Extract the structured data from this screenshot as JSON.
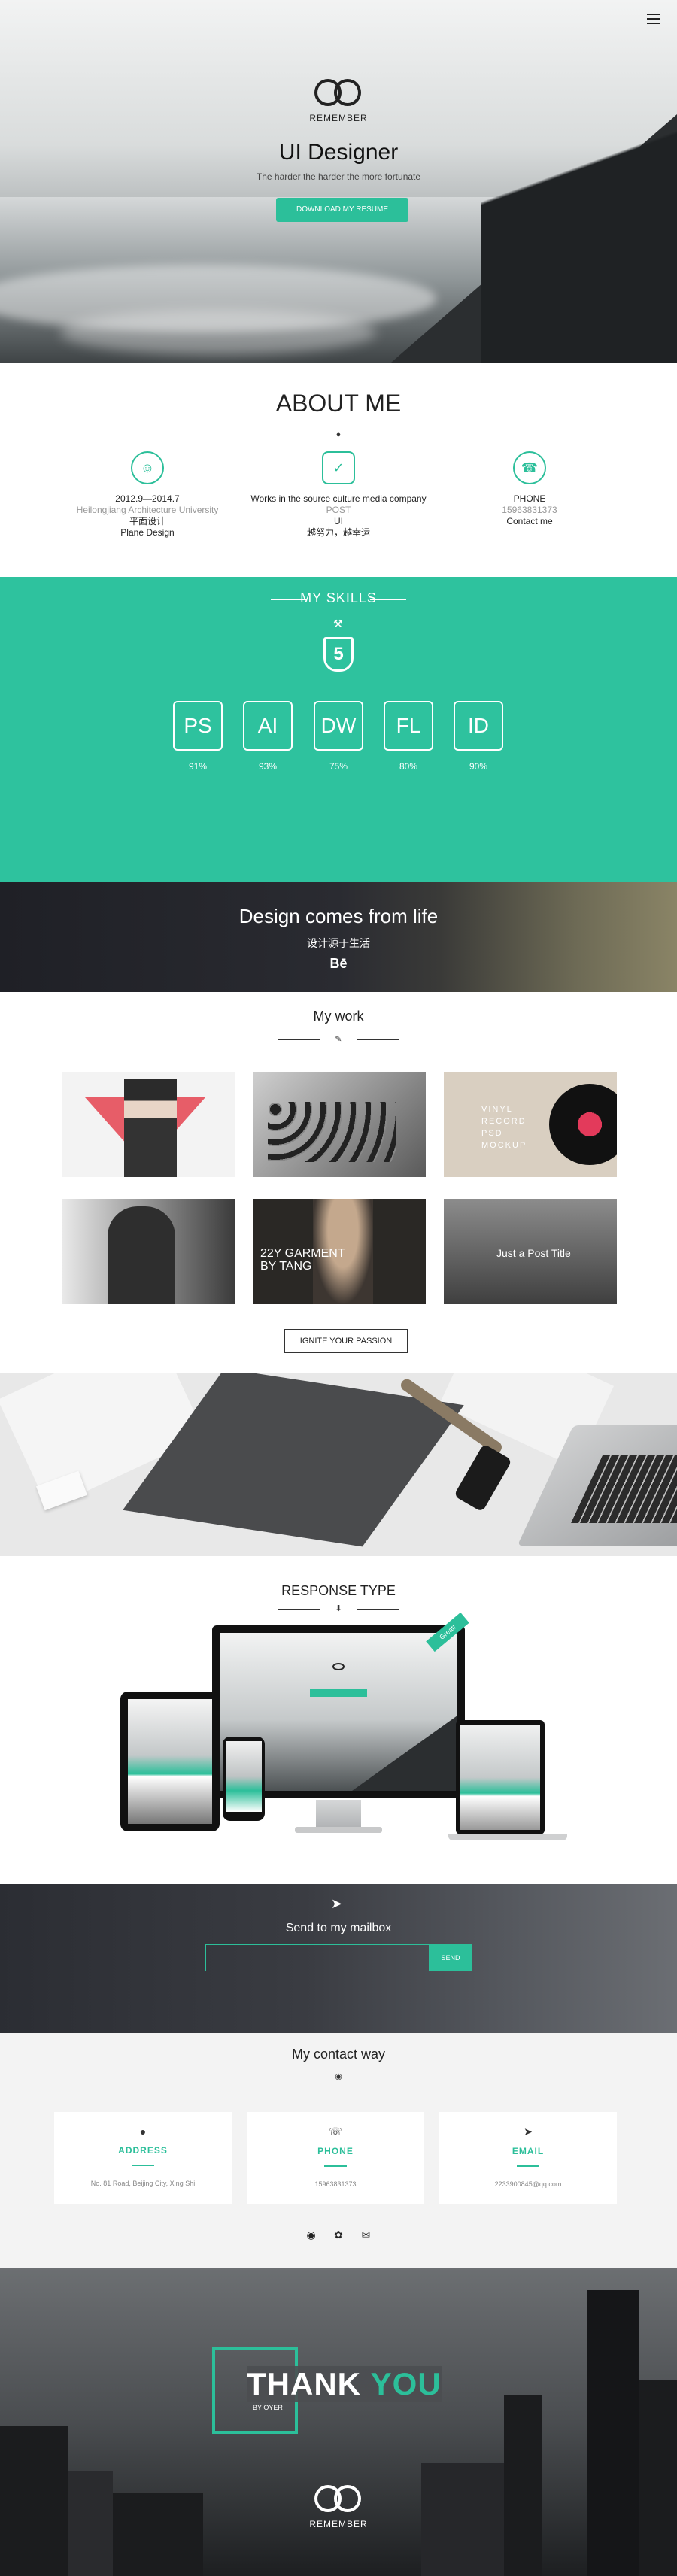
{
  "hero": {
    "logo_text": "REMEMBER",
    "title": "UI Designer",
    "tagline": "The harder the harder the more fortunate",
    "button": "DOWNLOAD MY RESUME"
  },
  "about": {
    "title": "ABOUT ME",
    "cols": [
      {
        "lines": [
          "2012.9—2014.7",
          "Heilongjiang Architecture University",
          "平面设计",
          "Plane Design"
        ]
      },
      {
        "lines": [
          "Works in the source culture media company",
          "POST",
          "UI",
          "越努力，越幸运"
        ]
      },
      {
        "lines": [
          "PHONE",
          "15963831373",
          "Contact me"
        ]
      }
    ]
  },
  "skills": {
    "title": "MY SKILLS",
    "badge": "5",
    "items": [
      {
        "label": "PS",
        "pct": "91%"
      },
      {
        "label": "AI",
        "pct": "93%"
      },
      {
        "label": "DW",
        "pct": "75%"
      },
      {
        "label": "FL",
        "pct": "80%"
      },
      {
        "label": "ID",
        "pct": "90%"
      }
    ]
  },
  "quote": {
    "line1": "Design comes from life",
    "line2": "设计源于生活",
    "line3": "Bē"
  },
  "work": {
    "title": "My work",
    "tiles": [
      {
        "caption": ""
      },
      {
        "caption": ""
      },
      {
        "caption": "VINYL RECORD PSD MOCKUP"
      },
      {
        "caption": ""
      },
      {
        "caption": "22Y GARMENT BY TANG"
      },
      {
        "caption": "Just a Post Title"
      }
    ],
    "button": "IGNITE YOUR PASSION"
  },
  "response": {
    "title": "RESPONSE TYPE",
    "ribbon": "Great!"
  },
  "mail": {
    "title": "Send to my mailbox",
    "placeholder": "",
    "button": "SEND"
  },
  "contact": {
    "title": "My contact way",
    "cards": [
      {
        "label": "ADDRESS",
        "value": "No. 81 Road, Beijing City, Xing Shi"
      },
      {
        "label": "PHONE",
        "value": "15963831373"
      },
      {
        "label": "EMAIL",
        "value": "2233900845@qq.com"
      }
    ]
  },
  "thanks": {
    "thank": "THANK",
    "you": "YOU",
    "by": "BY OYER",
    "logo_text": "REMEMBER"
  },
  "colors": {
    "accent": "#2cbf9a"
  }
}
